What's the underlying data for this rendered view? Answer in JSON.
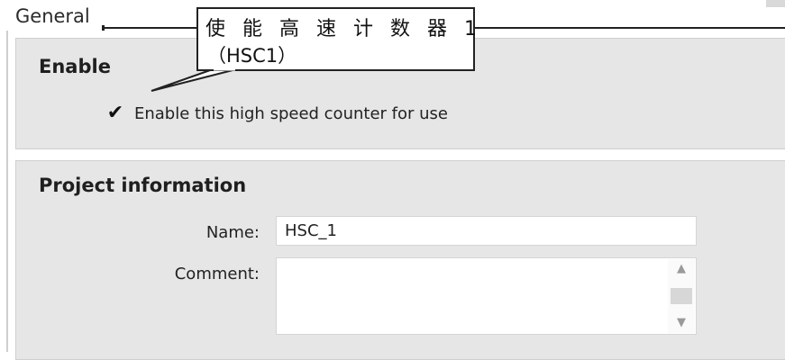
{
  "header": {
    "title": "General"
  },
  "annotation": {
    "line1": "使 能 高 速 计 数 器  1",
    "line2": "（HSC1）"
  },
  "enable_section": {
    "title": "Enable",
    "checkbox": {
      "checked": true,
      "glyph": "✔",
      "label": "Enable this high speed counter for use"
    }
  },
  "project_section": {
    "title": "Project information",
    "name_label": "Name:",
    "name_value": "HSC_1",
    "comment_label": "Comment:",
    "comment_value": ""
  },
  "icons": {
    "check": "check-icon",
    "scroll_up": "scroll-up-arrow-icon",
    "scroll_down": "scroll-down-arrow-icon"
  }
}
